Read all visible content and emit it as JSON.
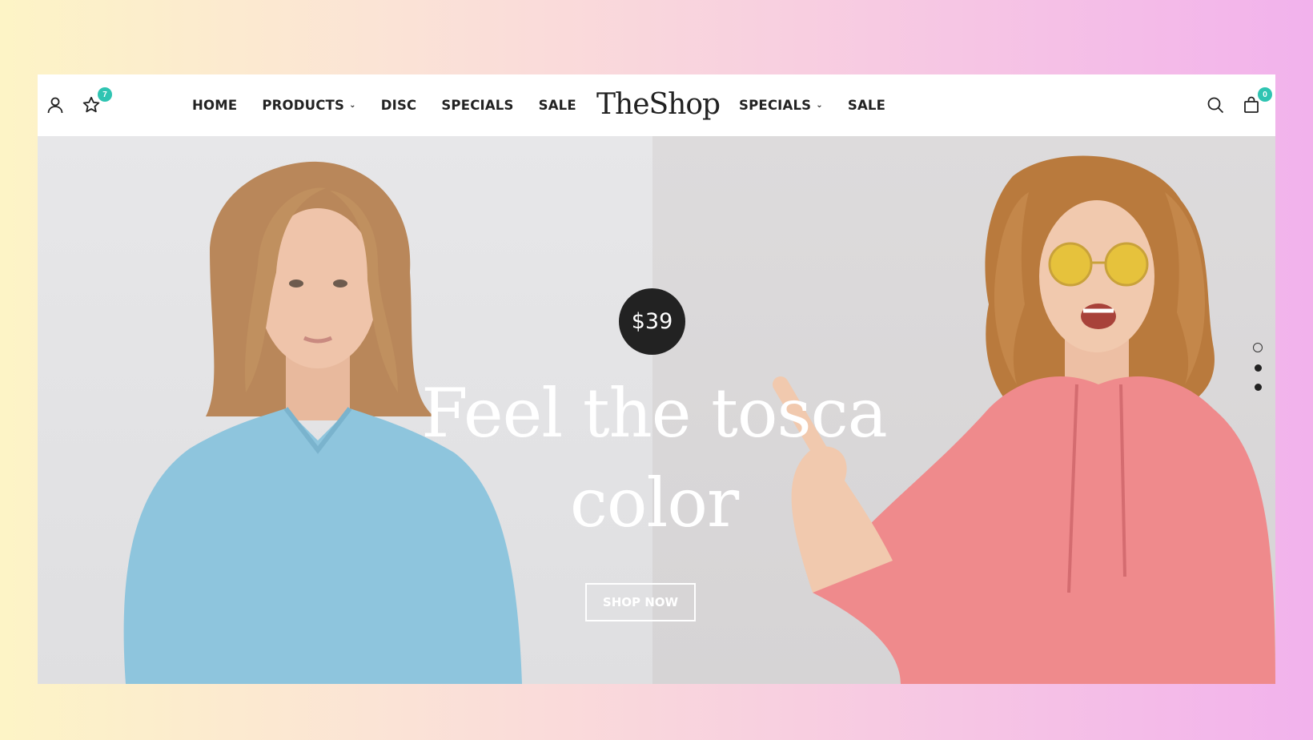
{
  "header": {
    "wishlist_count": "7",
    "cart_count": "0",
    "logo": "TheShop",
    "nav_left": [
      {
        "label": "HOME",
        "dropdown": false
      },
      {
        "label": "PRODUCTS",
        "dropdown": true
      },
      {
        "label": "DISC",
        "dropdown": false
      },
      {
        "label": "SPECIALS",
        "dropdown": false
      },
      {
        "label": "SALE",
        "dropdown": false
      }
    ],
    "nav_right": [
      {
        "label": "SPECIALS",
        "dropdown": true
      },
      {
        "label": "SALE",
        "dropdown": false
      }
    ]
  },
  "hero": {
    "price": "$39",
    "headline_line1": "Feel the tosca",
    "headline_line2": "color",
    "cta_label": "SHOP NOW",
    "slide_count": 3,
    "active_slide": 1
  },
  "colors": {
    "accent": "#2fc4b2",
    "dark": "#222222",
    "left_model_sweater": "#8ec5dd",
    "right_model_hoodie": "#ef8a8c"
  },
  "icons": [
    "user-icon",
    "star-icon",
    "search-icon",
    "bag-icon",
    "chevron-down-icon"
  ]
}
